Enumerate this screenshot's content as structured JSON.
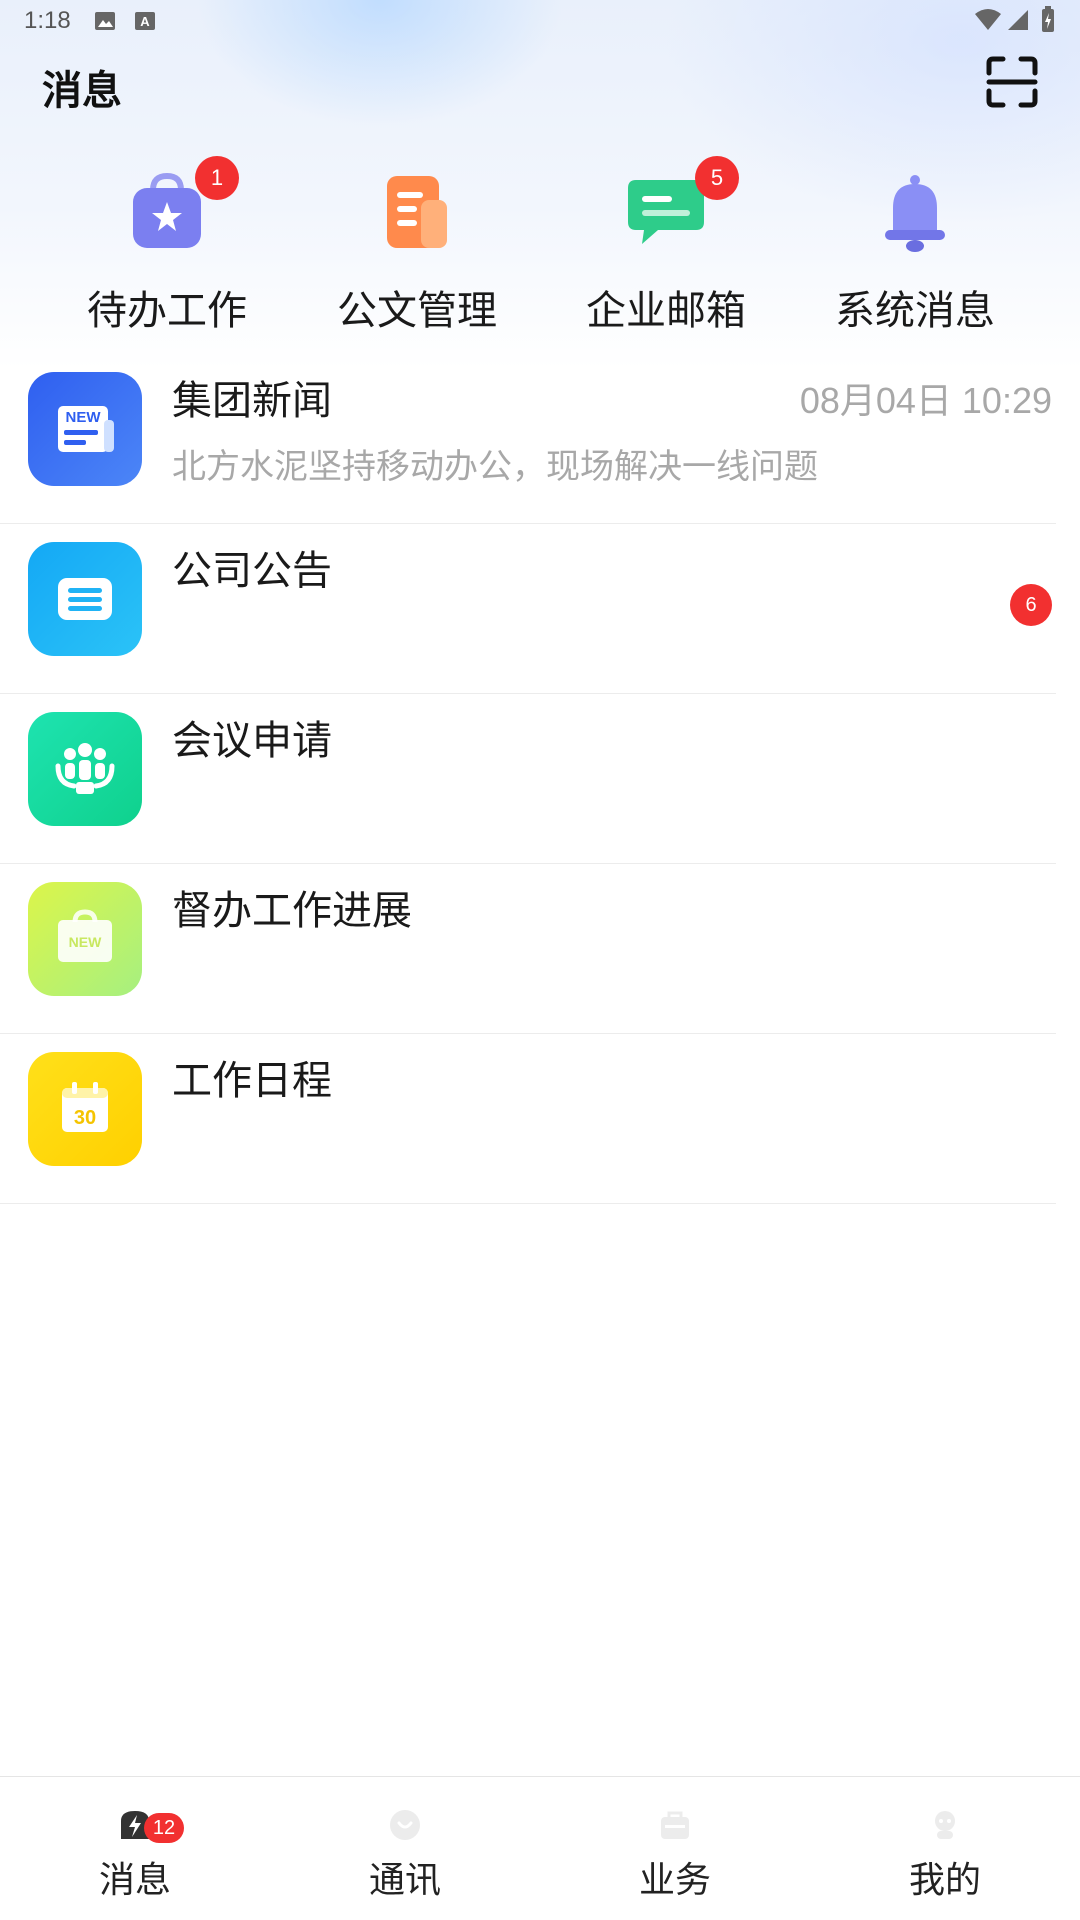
{
  "status_bar": {
    "time": "1:18"
  },
  "header": {
    "title": "消息"
  },
  "quick_entries": [
    {
      "label": "待办工作",
      "icon": "todo-bag-icon",
      "badge": "1"
    },
    {
      "label": "公文管理",
      "icon": "document-icon",
      "badge": ""
    },
    {
      "label": "企业邮箱",
      "icon": "mail-chat-icon",
      "badge": "5"
    },
    {
      "label": "系统消息",
      "icon": "bell-icon",
      "badge": ""
    }
  ],
  "messages": [
    {
      "title": "集团新闻",
      "time": "08月04日 10:29",
      "preview": "北方水泥坚持移动办公，现场解决一线问题",
      "icon": "news-icon",
      "icon_text": "NEW",
      "badge": ""
    },
    {
      "title": "公司公告",
      "time": "",
      "preview": "",
      "icon": "announcement-icon",
      "badge": "6"
    },
    {
      "title": "会议申请",
      "time": "",
      "preview": "",
      "icon": "meeting-icon",
      "badge": ""
    },
    {
      "title": "督办工作进展",
      "time": "",
      "preview": "",
      "icon": "supervise-icon",
      "icon_text": "NEW",
      "badge": ""
    },
    {
      "title": "工作日程",
      "time": "",
      "preview": "",
      "icon": "calendar-icon",
      "icon_text": "30",
      "badge": ""
    }
  ],
  "tab_bar": {
    "tabs": [
      {
        "label": "消息",
        "icon": "message-tab-icon",
        "active": true,
        "badge": "12"
      },
      {
        "label": "通讯",
        "icon": "contacts-tab-icon",
        "active": false
      },
      {
        "label": "业务",
        "icon": "business-tab-icon",
        "active": false
      },
      {
        "label": "我的",
        "icon": "profile-tab-icon",
        "active": false
      }
    ]
  },
  "colors": {
    "badge": "#f23030",
    "todo": "#7b7ff0",
    "document": "#ff8a4c",
    "mail": "#2ecc8a",
    "bell": "#8a8ff5",
    "news": "#3b6cf2",
    "announcement": "#20b3f5",
    "meeting": "#14d9a0",
    "supervise": "#c8f060",
    "calendar": "#ffd11a"
  }
}
